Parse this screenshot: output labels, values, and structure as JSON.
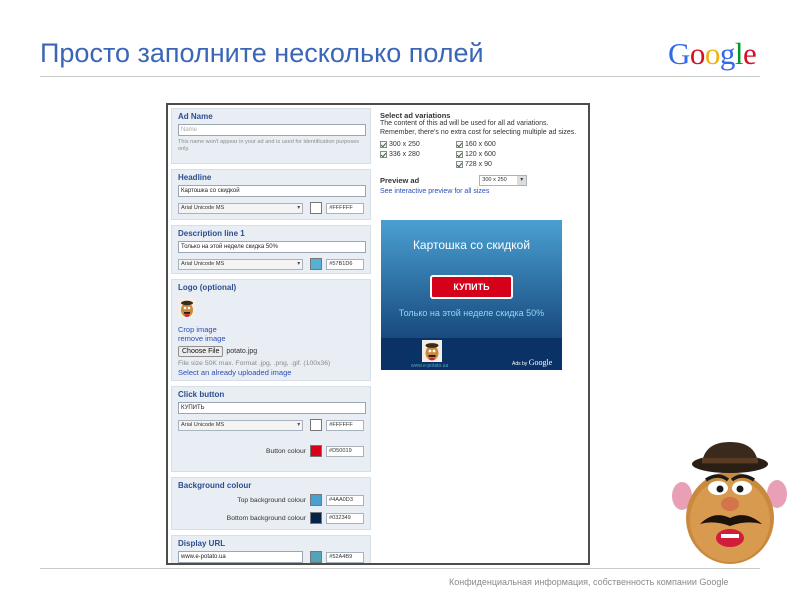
{
  "slide": {
    "title": "Просто заполните несколько полей",
    "logo_text": "Google",
    "logo_letters": [
      "G",
      "o",
      "o",
      "g",
      "l",
      "e"
    ],
    "logo_colors": [
      "#3369e8",
      "#d50f25",
      "#eeb211",
      "#3369e8",
      "#009925",
      "#d50f25"
    ],
    "footer": "Конфиденциальная информация, собственность компании Google"
  },
  "form": {
    "ad_name": {
      "title": "Ad Name",
      "placeholder": "Name",
      "hint": "This name won't appear in your ad and is used for identification purposes only."
    },
    "headline": {
      "title": "Headline",
      "value": "Картошка со скидкой",
      "font": "Arial Unicode MS",
      "color_hex": "#FFFFFF",
      "swatch": "#ffffff"
    },
    "description": {
      "title": "Description line 1",
      "value": "Только на этой неделе скидка 50%",
      "font": "Arial Unicode MS",
      "color_hex": "#57B1D6",
      "swatch": "#57b1d6"
    },
    "logo": {
      "title": "Logo (optional)",
      "crop_link": "Crop image",
      "remove_link": "remove image",
      "choose_button": "Choose File",
      "file_name": "potato.jpg",
      "file_hint": "File size 50K max. Format .jpg, .png, .gif. (100x36)",
      "uploaded_link": "Select an already uploaded image"
    },
    "click_button": {
      "title": "Click button",
      "value": "КУПИТЬ",
      "font": "Arial Unicode MS",
      "color_hex": "#FFFFFF",
      "swatch": "#ffffff",
      "button_colour_label": "Button colour",
      "button_colour_hex": "#D50019",
      "button_swatch": "#d50019"
    },
    "background": {
      "title": "Background colour",
      "top_label": "Top background colour",
      "top_hex": "#4AA0D3",
      "top_swatch": "#4aa0d3",
      "bottom_label": "Bottom background colour",
      "bottom_hex": "#032349",
      "bottom_swatch": "#032349"
    },
    "display_url": {
      "title": "Display URL",
      "value": "www.e-potato.ua",
      "color_hex": "#52A4B9",
      "swatch": "#52a4b9"
    }
  },
  "variations": {
    "title": "Select ad variations",
    "description": "The content of this ad will be used for all ad variations. Remember, there's no extra cost for selecting multiple ad sizes.",
    "sizes_col1": [
      "300 x 250",
      "336 x 280"
    ],
    "sizes_col2": [
      "160 x 600",
      "120 x 600",
      "728 x 90"
    ]
  },
  "preview": {
    "label": "Preview ad",
    "selected_size": "300 x 250",
    "link": "See interactive preview for all sizes"
  },
  "ad": {
    "headline": "Картошка со скидкой",
    "button": "КУПИТЬ",
    "description": "Только на этой неделе скидка 50%",
    "url": "www.e-potato.ua",
    "ads_by": "Ads by",
    "ads_by_brand": "Google"
  }
}
